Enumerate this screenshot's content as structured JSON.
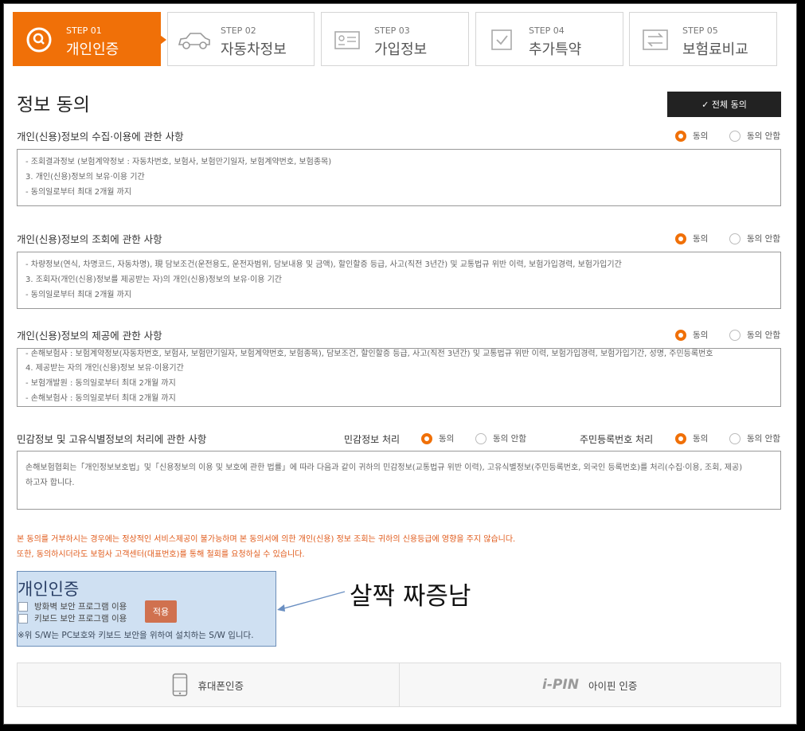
{
  "steps": [
    {
      "num": "STEP 01",
      "title": "개인인증",
      "icon": "search-badge-icon",
      "active": true
    },
    {
      "num": "STEP 02",
      "title": "자동차정보",
      "icon": "car-icon",
      "active": false
    },
    {
      "num": "STEP 03",
      "title": "가입정보",
      "icon": "id-card-icon",
      "active": false
    },
    {
      "num": "STEP 04",
      "title": "추가특약",
      "icon": "checkbox-icon",
      "active": false
    },
    {
      "num": "STEP 05",
      "title": "보험료비교",
      "icon": "compare-arrows-icon",
      "active": false
    }
  ],
  "page_title": "정보 동의",
  "all_agree_label": "✓ 전체 동의",
  "agree_label": "동의",
  "disagree_label": "동의 안함",
  "sections": [
    {
      "title": "개인(신용)정보의 수집·이용에 관한 사항",
      "agree": true,
      "lines": [
        "- 조회결과정보 (보험계약정보 : 자동차번호, 보험사, 보험만기일자, 보험계약번호, 보험종목)",
        "3. 개인(신용)정보의 보유·이용 기간",
        "- 동의일로부터 최대 2개월 까지"
      ]
    },
    {
      "title": "개인(신용)정보의 조회에 관한 사항",
      "agree": true,
      "lines": [
        "- 차량정보(연식, 차명코드, 자동차명), 現 담보조건(운전용도, 운전자범위, 담보내용 및 금액), 할인할증 등급, 사고(직전 3년간) 및 교통법규 위반 이력, 보험가입경력, 보험가입기간",
        "3. 조회자(개인(신용)정보를 제공받는 자)의 개인(신용)정보의 보유·이용 기간",
        "- 동의일로부터 최대 2개월 까지"
      ]
    },
    {
      "title": "개인(신용)정보의 제공에 관한 사항",
      "agree": true,
      "lines": [
        "- 손해보험사 : 보험계약정보(자동차번호, 보험사, 보험만기일자, 보험계약번호, 보험종목), 담보조건, 할인할증 등급, 사고(직전 3년간) 및 교통법규 위반 이력, 보험가입경력, 보험가입기간, 성명, 주민등록번호",
        "4. 제공받는 자의 개인(신용)정보 보유·이용기간",
        "- 보험개발원 : 동의일로부터 최대 2개월 까지",
        "- 손해보험사 : 동의일로부터 최대 2개월 까지"
      ]
    }
  ],
  "sensitive": {
    "title": "민감정보 및 고유식별정보의 처리에 관한 사항",
    "sens_label": "민감정보 처리",
    "sens_agree": true,
    "rrn_label": "주민등록번호 처리",
    "rrn_agree": true,
    "text": "손해보험협회는「개인정보보호법」및「신용정보의 이용 및 보호에 관한 법률」에 따라 다음과 같이 귀하의 민감정보(교통법규 위반 이력), 고유식별정보(주민등록번호, 외국인 등록번호)를 처리(수집·이용, 조회, 제공)",
    "text2": "하고자 합니다."
  },
  "warning": {
    "line1": "본 동의를 거부하시는 경우에는 정상적인 서비스제공이 불가능하며 본 동의서에 의한 개인(신용) 정보 조회는 귀하의 신용등급에 영향을 주지 않습니다.",
    "line2": "또한, 동의하시더라도 보험사 고객센터(대표번호)를 통해 철회를 요청하실 수 있습니다."
  },
  "auth": {
    "title": "개인인증",
    "option1": "방화벽 보안 프로그램 이용",
    "option2": "키보드 보안 프로그램 이용",
    "apply": "적용",
    "note": "※위 S/W는 PC보호와 키보드 보안을 위하여 설치하는 S/W 입니다."
  },
  "annotation": "살짝 짜증남",
  "tabs": {
    "phone": "휴대폰인증",
    "ipin_logo": "i-PIN",
    "ipin": "아이핀 인증"
  },
  "colors": {
    "accent": "#f07008",
    "dark": "#222222"
  }
}
